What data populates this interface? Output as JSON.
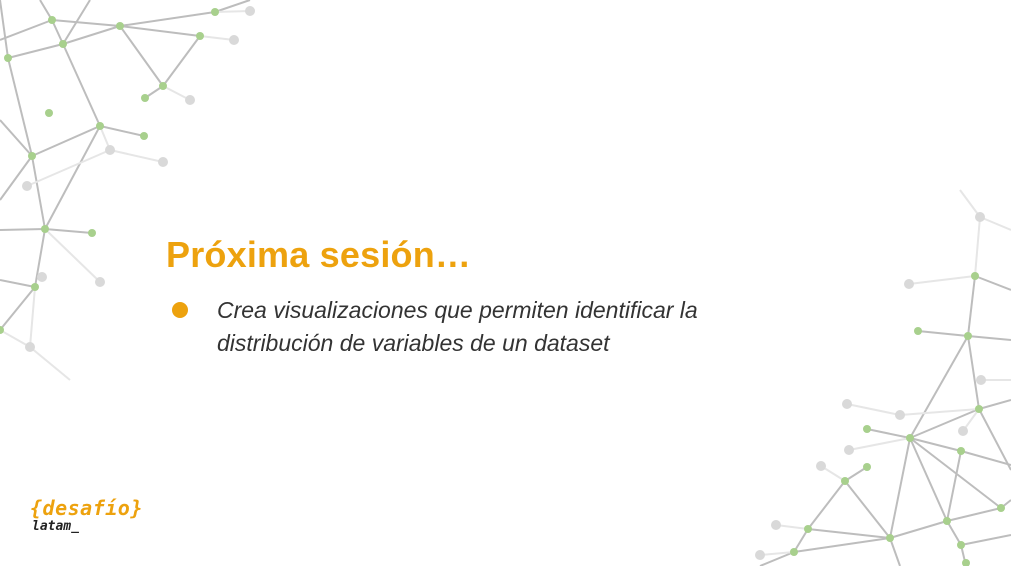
{
  "slide": {
    "title": "Próxima sesión…",
    "bullets": [
      {
        "lines": [
          "Crea visualizaciones que permiten identificar la",
          "distribución de variables de un dataset"
        ]
      }
    ]
  },
  "logo": {
    "top": "{desafío}",
    "bottom": "latam_"
  },
  "colors": {
    "accent": "#eda20e",
    "node_green": "#a8d08d",
    "node_gray": "#d9d9d9",
    "line_gray": "#bfbfbf",
    "text": "#333333"
  }
}
